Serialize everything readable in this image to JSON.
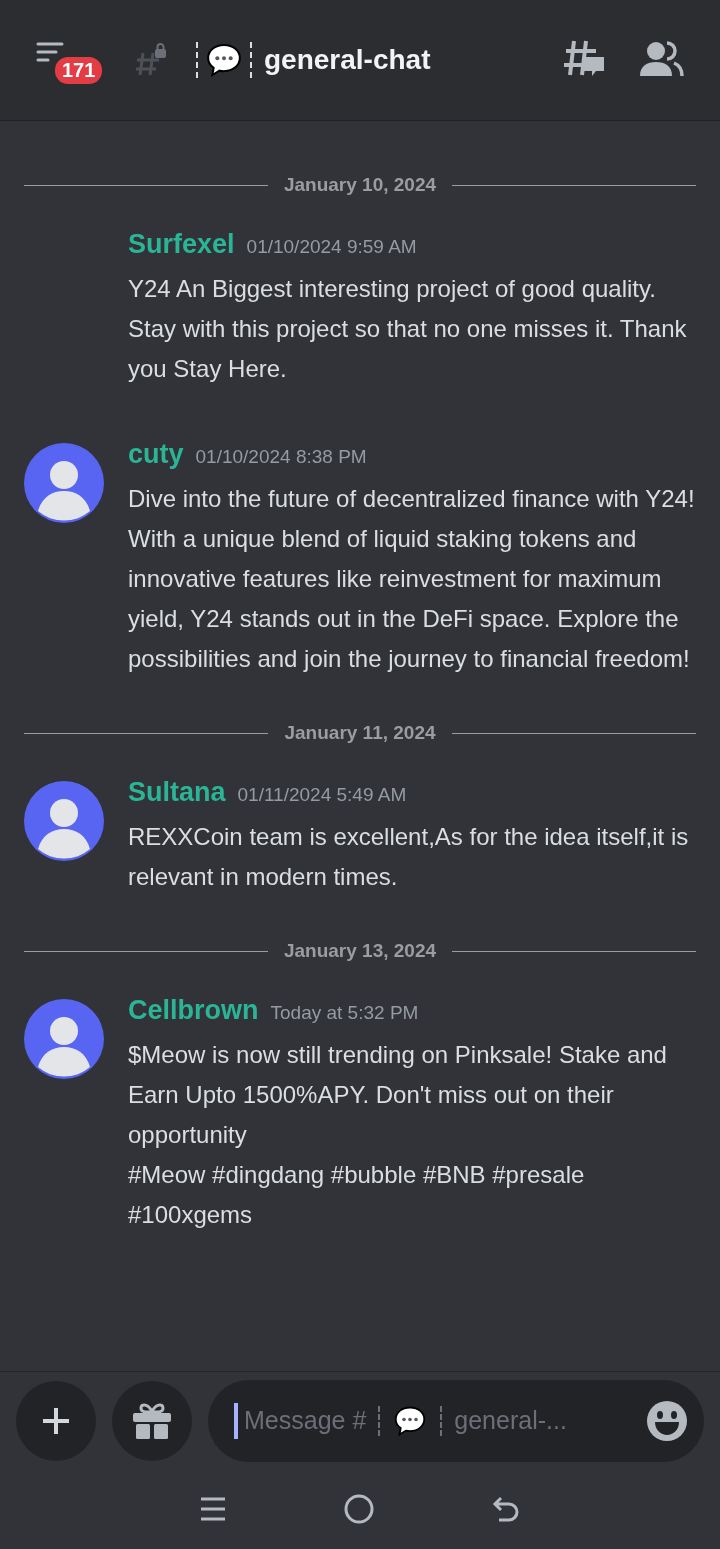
{
  "header": {
    "badge": "171",
    "channel": "general-chat"
  },
  "messages": [
    {
      "kind": "divider",
      "date": "January 10, 2024"
    },
    {
      "kind": "message",
      "author": "Surfexel",
      "time": "01/10/2024 9:59 AM",
      "avatar": false,
      "paragraphs": [
        "Y24 An Biggest  interesting project of good quality. Stay with this project so that no one misses it. Thank you Stay Here."
      ]
    },
    {
      "kind": "message",
      "author": "cuty",
      "time": "01/10/2024 8:38 PM",
      "avatar": true,
      "paragraphs": [
        "Dive into the future of decentralized finance with Y24!  With a unique blend of liquid staking tokens and innovative features like reinvestment for maximum yield, Y24 stands out in the DeFi space. Explore the possibilities and join the journey to financial freedom!"
      ]
    },
    {
      "kind": "divider",
      "date": "January 11, 2024"
    },
    {
      "kind": "message",
      "author": "Sultana",
      "time": "01/11/2024 5:49 AM",
      "avatar": true,
      "paragraphs": [
        "REXXCoin team is excellent,As for the idea itself,it is relevant in modern times."
      ]
    },
    {
      "kind": "divider",
      "date": "January 13, 2024"
    },
    {
      "kind": "message",
      "author": "Cellbrown",
      "time": "Today at 5:32 PM",
      "avatar": true,
      "paragraphs": [
        "$Meow is now still trending on Pinksale! Stake and Earn Upto 1500%APY. Don't miss out on their opportunity",
        "#Meow #dingdang #bubble #BNB #presale #100xgems"
      ]
    }
  ],
  "composer": {
    "placeholder_start": "Message #",
    "placeholder_end": "general-..."
  }
}
